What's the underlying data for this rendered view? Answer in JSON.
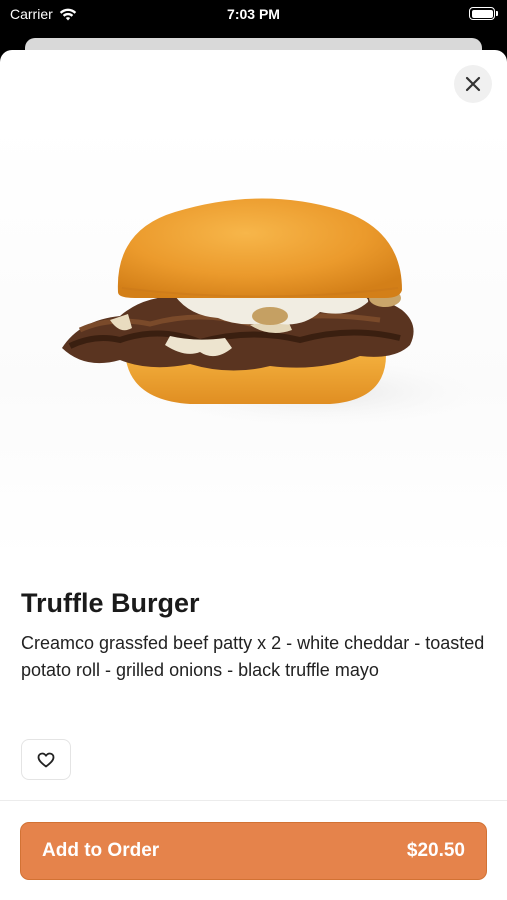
{
  "status_bar": {
    "carrier": "Carrier",
    "time": "7:03 PM",
    "icons": [
      "wifi-icon",
      "battery-icon"
    ]
  },
  "item": {
    "image_alt": "Truffle Burger",
    "title": "Truffle Burger",
    "description": "Creamco grassfed beef patty x 2 - white cheddar - toasted potato roll - grilled onions - black truffle mayo"
  },
  "actions": {
    "close_icon": "close-icon",
    "favorite_icon": "heart-icon",
    "add_label": "Add to Order",
    "price": "$20.50"
  },
  "colors": {
    "accent": "#e5834b",
    "title": "#1a1a1a",
    "text": "#222222"
  }
}
